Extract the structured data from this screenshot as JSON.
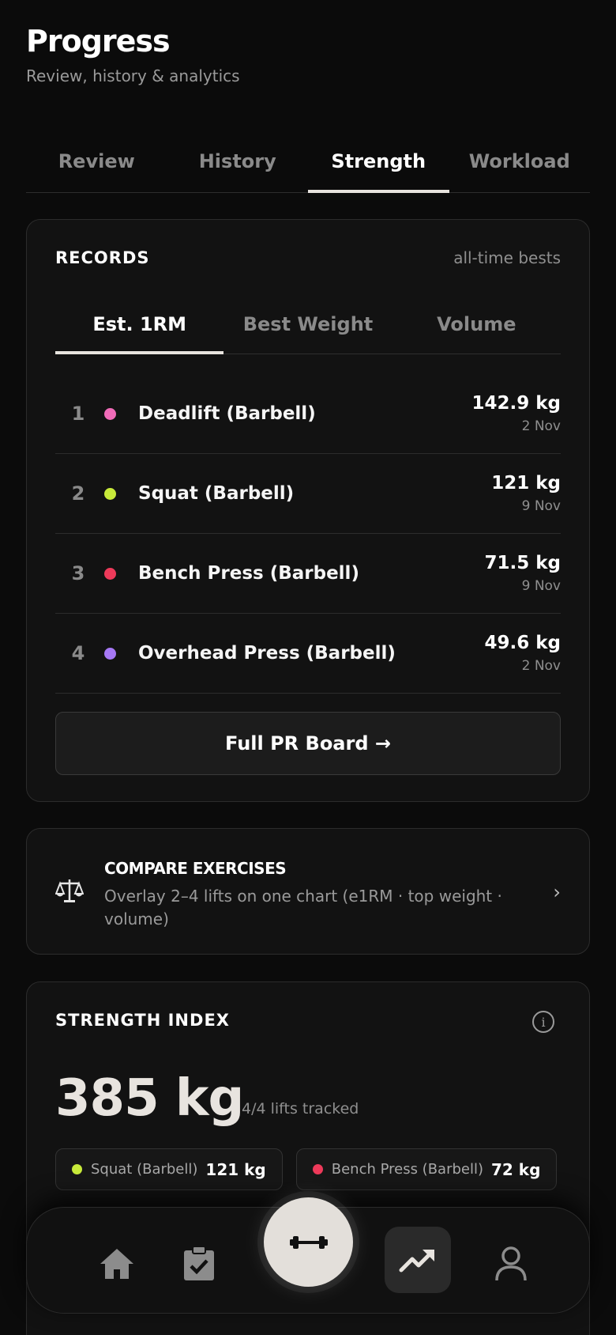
{
  "header": {
    "title": "Progress",
    "subtitle": "Review, history & analytics"
  },
  "tabs": [
    {
      "label": "Review",
      "active": false
    },
    {
      "label": "History",
      "active": false
    },
    {
      "label": "Strength",
      "active": true
    },
    {
      "label": "Workload",
      "active": false
    }
  ],
  "records": {
    "title": "RECORDS",
    "note": "all-time bests",
    "subtabs": [
      {
        "label": "Est. 1RM",
        "active": true
      },
      {
        "label": "Best Weight",
        "active": false
      },
      {
        "label": "Volume",
        "active": false
      }
    ],
    "rows": [
      {
        "rank": "1",
        "name": "Deadlift (Barbell)",
        "value": "142.9 kg",
        "date": "2 Nov",
        "color": "#f06bb8"
      },
      {
        "rank": "2",
        "name": "Squat (Barbell)",
        "value": "121 kg",
        "date": "9 Nov",
        "color": "#c8ea3a"
      },
      {
        "rank": "3",
        "name": "Bench Press (Barbell)",
        "value": "71.5 kg",
        "date": "9 Nov",
        "color": "#ee3a5a"
      },
      {
        "rank": "4",
        "name": "Overhead Press (Barbell)",
        "value": "49.6 kg",
        "date": "2 Nov",
        "color": "#a678f5"
      }
    ],
    "button_label": "Full PR Board →"
  },
  "compare": {
    "icon": "scale-icon",
    "title": "COMPARE EXERCISES",
    "description": "Overlay 2–4 lifts on one chart (e1RM · top weight · volume)",
    "chevron": "›"
  },
  "strength_index": {
    "title": "STRENGTH INDEX",
    "info_glyph": "i",
    "value": "385 kg",
    "note": "4/4 lifts tracked",
    "chips": [
      {
        "name": "Squat (Barbell)",
        "value": "121 kg",
        "color": "#c8ea3a"
      },
      {
        "name": "Bench Press (Barbell)",
        "value": "72 kg",
        "color": "#ee3a5a"
      }
    ]
  },
  "nav": {
    "items": [
      "home-icon",
      "clipboard-check-icon",
      "dumbbell-icon",
      "trending-up-icon",
      "user-icon"
    ],
    "active": "trending-up-icon"
  }
}
